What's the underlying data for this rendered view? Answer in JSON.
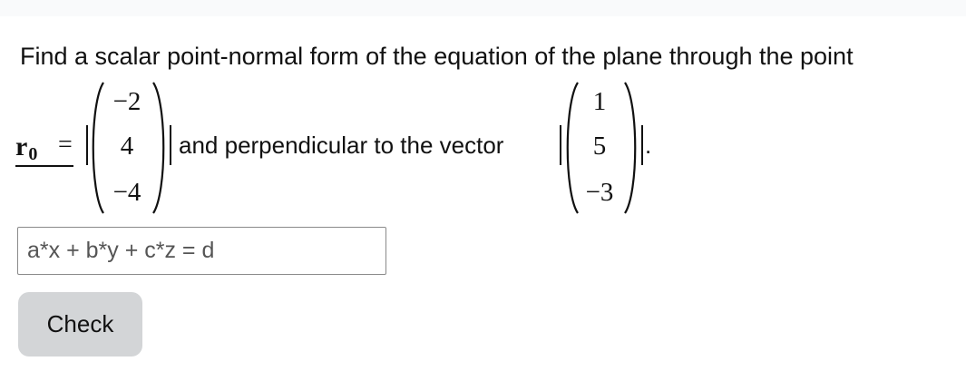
{
  "question": {
    "intro_text": "Find a scalar point-normal form of the equation of the plane through the point",
    "point_vector_name": "r",
    "point_vector_subscript": "0",
    "equals_sign": "=",
    "point_components": [
      "−2",
      "4",
      "−4"
    ],
    "middle_text": "and perpendicular to the vector",
    "normal_components": [
      "1",
      "5",
      "−3"
    ],
    "end_punctuation": "."
  },
  "answer_input": {
    "value": "",
    "placeholder": "a*x + b*y + c*z = d"
  },
  "check_button": {
    "label": "Check"
  }
}
